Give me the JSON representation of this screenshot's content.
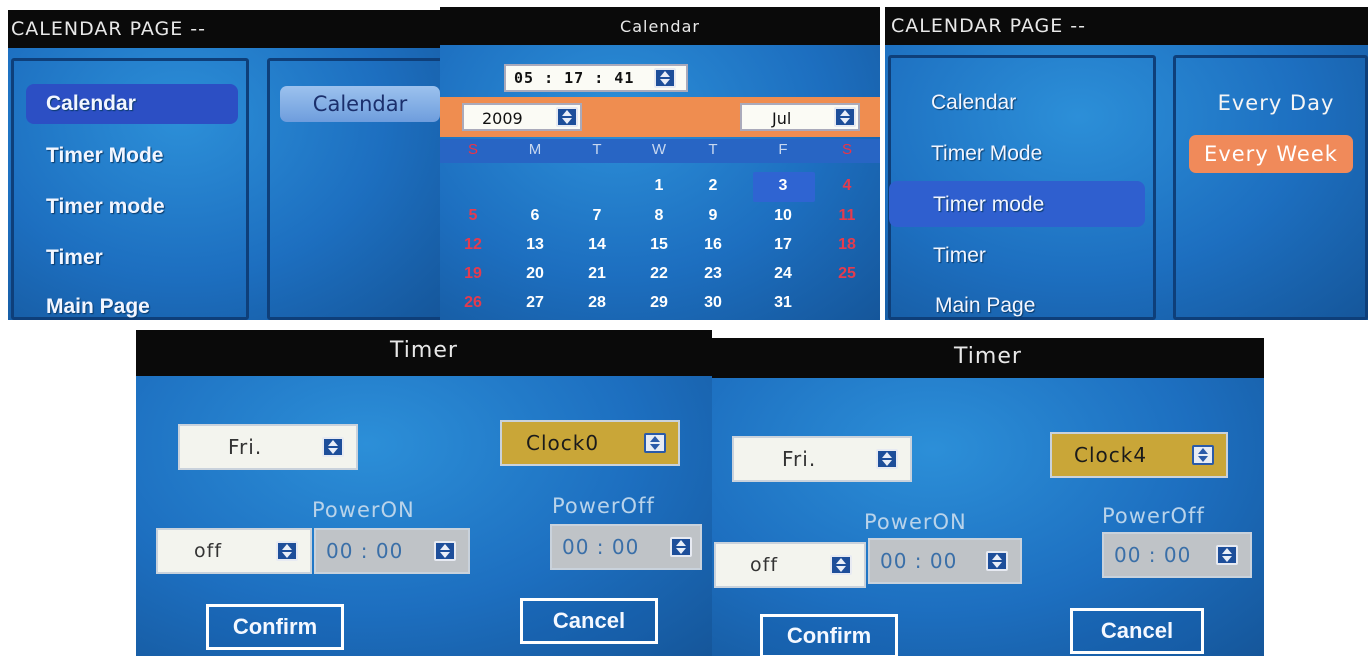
{
  "menu_screen_1": {
    "title": "CALENDAR PAGE --",
    "items": [
      "Calendar",
      "Timer Mode",
      "Timer mode",
      "Timer",
      "Main Page"
    ],
    "selected_index": 0,
    "submenu": [
      "Calendar"
    ]
  },
  "calendar_screen": {
    "title": "Calendar",
    "time": "05 : 17 : 41",
    "year": "2009",
    "month": "Jul",
    "weekdays": [
      "S",
      "M",
      "T",
      "W",
      "T",
      "F",
      "S"
    ],
    "weeks": [
      [
        "",
        "",
        "",
        "1",
        "2",
        "3",
        "4"
      ],
      [
        "5",
        "6",
        "7",
        "8",
        "9",
        "10",
        "11"
      ],
      [
        "12",
        "13",
        "14",
        "15",
        "16",
        "17",
        "18"
      ],
      [
        "19",
        "20",
        "21",
        "22",
        "23",
        "24",
        "25"
      ],
      [
        "26",
        "27",
        "28",
        "29",
        "30",
        "31",
        ""
      ]
    ],
    "today": "3"
  },
  "menu_screen_2": {
    "title": "CALENDAR PAGE --",
    "items": [
      "Calendar",
      "Timer Mode",
      "Timer mode",
      "Timer",
      "Main Page"
    ],
    "selected_index": 2,
    "submenu": [
      "Every Day",
      "Every Week"
    ],
    "submenu_selected_index": 1
  },
  "timer_screen_1": {
    "title": "Timer",
    "day": "Fri.",
    "clock": "Clock0",
    "power_on_label": "PowerON",
    "power_off_label": "PowerOff",
    "mode": "off",
    "power_on_time": "00 : 00",
    "power_off_time": "00 : 00",
    "confirm_label": "Confirm",
    "cancel_label": "Cancel"
  },
  "timer_screen_2": {
    "title": "Timer",
    "day": "Fri.",
    "clock": "Clock4",
    "power_on_label": "PowerON",
    "power_off_label": "PowerOff",
    "mode": "off",
    "power_on_time": "00 : 00",
    "power_off_time": "00 : 00",
    "confirm_label": "Confirm",
    "cancel_label": "Cancel"
  },
  "colors": {
    "screen_blue": "#1d6fc0",
    "title_bar": "#0a0a0a",
    "selection_blue": "#2f5fcf",
    "selection_orange": "#f08a5a",
    "weekend_red": "#e53b4e",
    "clock_gold": "#c9a638"
  }
}
